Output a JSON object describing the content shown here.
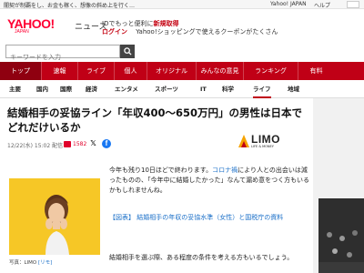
{
  "topbar": {
    "promo": "闇契が制覇をし、お金も稼く、想像の斜め上を行く…",
    "yahoo_japan": "Yahoo! JAPAN",
    "top_link": "ヘルプ"
  },
  "header": {
    "logo": "YAHOO!",
    "logo_sub": "JAPAN",
    "news_label": "ニュース",
    "id_line_a": "IDでもっと便利に",
    "id_line_b": "新規取得",
    "login_label": "ログイン",
    "coupon_text": "　 Yahoo!ショッピングで使えるクーポンがたくさん",
    "search_placeholder": "キーワードを入力",
    "search_button": "🔍"
  },
  "nav": [
    "トップ",
    "速報",
    "ライブ",
    "個人",
    "オリジナル",
    "みんなの意見",
    "ランキング",
    "有料"
  ],
  "subnav": [
    "主要",
    "国内",
    "国際",
    "経済",
    "エンタメ",
    "スポーツ",
    "IT",
    "科学",
    "ライフ",
    "地域"
  ],
  "subnav_active": "ライフ",
  "article": {
    "title": "結婚相手の妥協ライン「年収400～650万円」の男性は日本でどれだけいるか",
    "date": "12/22(水) 15:02 配信",
    "comment_count": "1582",
    "publisher_logo": "LIMO",
    "publisher_sub": "LIFE & MONEY",
    "caption_prefix": "写真：LIMO ",
    "caption_link": "[リモ]",
    "para1": "今年も残り10日ほどで終わります。",
    "para1_link": "コロナ禍",
    "para1_rest": "により人との出会いは減ったものの、「今年中に結婚したかった」なんて漏め意をつく方もいるかもしれませんね。",
    "figure_link": "【図表】 結婚相手の年収の妥協水準（女性）と国税庁の資料",
    "para2": "結婚相手を選ぶ際、ある程度の条件を考える方もいるでしょう。"
  },
  "icons": {
    "comment": "comment-icon",
    "twitter": "twitter-icon",
    "facebook": "facebook-icon"
  },
  "colors": {
    "brand_red": "#c00016",
    "link_blue": "#1a6fc8",
    "photo_yellow": "#f6c726"
  }
}
